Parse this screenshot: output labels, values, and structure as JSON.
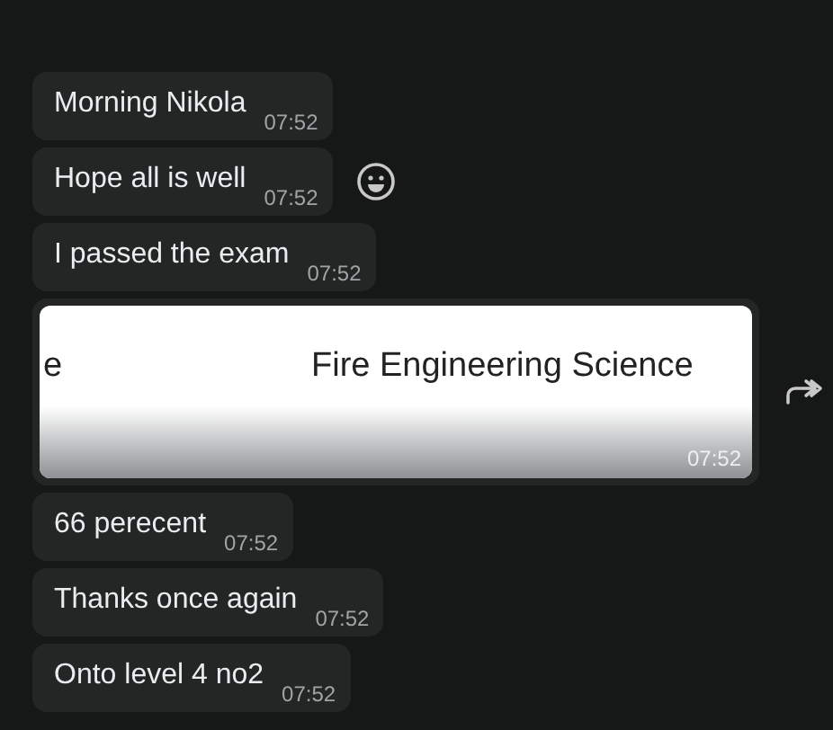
{
  "messages": [
    {
      "kind": "text",
      "text": "Morning Nikola",
      "time": "07:52",
      "hovered": false
    },
    {
      "kind": "text",
      "text": "Hope all is well",
      "time": "07:52",
      "hovered": true
    },
    {
      "kind": "text",
      "text": "I passed the exam",
      "time": "07:52",
      "hovered": false
    },
    {
      "kind": "image",
      "image_texts": [
        "e",
        "Fire Engineering Science"
      ],
      "time": "07:52",
      "hovered": true
    },
    {
      "kind": "text",
      "text": "66 perecent",
      "time": "07:52",
      "hovered": false
    },
    {
      "kind": "text",
      "text": "Thanks once again",
      "time": "07:52",
      "hovered": false
    },
    {
      "kind": "text",
      "text": "Onto level 4 no2",
      "time": "07:52",
      "hovered": false
    }
  ]
}
